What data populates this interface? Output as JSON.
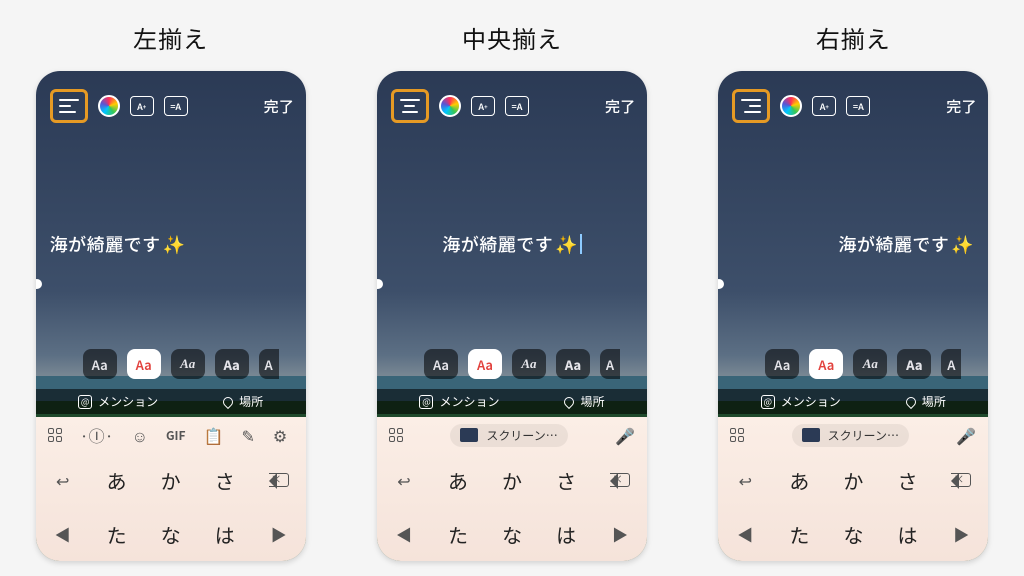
{
  "columns": [
    {
      "title": "左揃え",
      "align": "left"
    },
    {
      "title": "中央揃え",
      "align": "center"
    },
    {
      "title": "右揃え",
      "align": "right"
    }
  ],
  "topbar": {
    "font_size_icon_label": "A⁺",
    "text_effect_icon_label": "⿴A",
    "done_label": "完了"
  },
  "caption_text": "海が綺麗です",
  "sparkle": "✨",
  "font_chips": [
    "Aa",
    "Aa",
    "Aa",
    "Aa",
    "A"
  ],
  "selected_font_index": 1,
  "tags": {
    "mention_label": "メンション",
    "mention_icon": "@",
    "place_label": "場所"
  },
  "keyboard": {
    "suggestion_label": "スクリーン…",
    "tool_left_variant_icons": [
      "grid",
      "cursor",
      "sticker",
      "gif",
      "clipboard",
      "pen",
      "settings"
    ],
    "row1": [
      "←",
      "あ",
      "か",
      "さ",
      "⌫"
    ],
    "row2": [
      "◀",
      "た",
      "な",
      "は",
      "▶"
    ]
  }
}
